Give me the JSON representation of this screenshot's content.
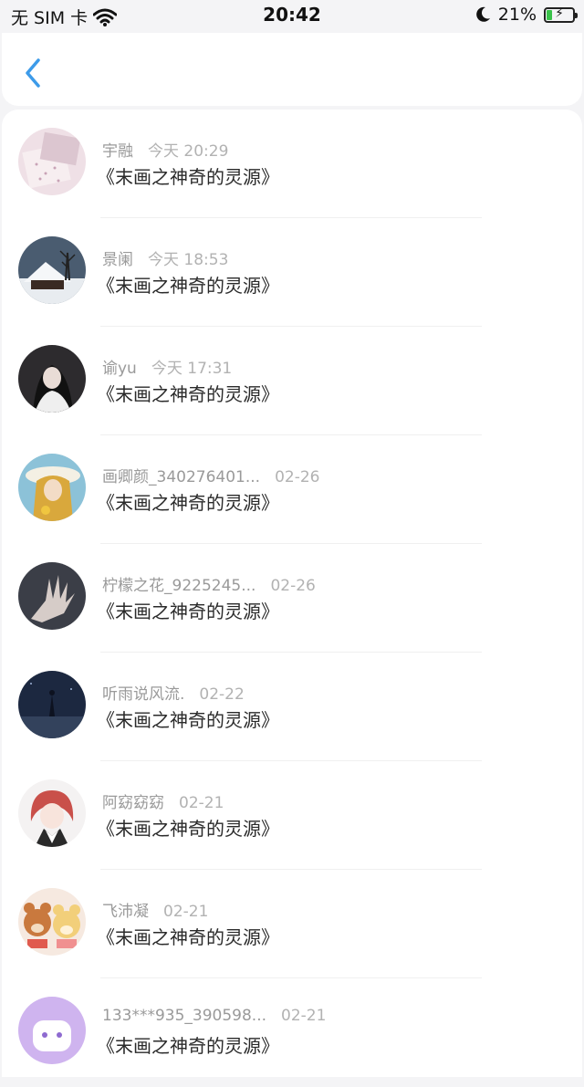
{
  "status_bar": {
    "carrier": "无 SIM 卡",
    "time": "20:42",
    "battery_percent": "21%",
    "battery_level": 0.21
  },
  "header": {
    "back_icon": "chevron-left-icon",
    "accent_color": "#3d9be9"
  },
  "items": [
    {
      "name": "宇融",
      "time": "今天 20:29",
      "title": "《末画之神奇的灵源》"
    },
    {
      "name": "景阑",
      "time": "今天 18:53",
      "title": "《末画之神奇的灵源》"
    },
    {
      "name": "谕yu",
      "time": "今天 17:31",
      "title": "《末画之神奇的灵源》"
    },
    {
      "name": "画卿颜_340276401...",
      "time": "02-26",
      "title": "《末画之神奇的灵源》"
    },
    {
      "name": "柠檬之花_9225245...",
      "time": "02-26",
      "title": "《末画之神奇的灵源》"
    },
    {
      "name": "听雨说风流.",
      "time": "02-22",
      "title": "《末画之神奇的灵源》"
    },
    {
      "name": "阿窈窈窈",
      "time": "02-21",
      "title": "《末画之神奇的灵源》"
    },
    {
      "name": "飞沛凝",
      "time": "02-21",
      "title": "《末画之神奇的灵源》"
    },
    {
      "name": "133***935_390598...",
      "time": "02-21",
      "title": "《末画之神奇的灵源》"
    }
  ]
}
